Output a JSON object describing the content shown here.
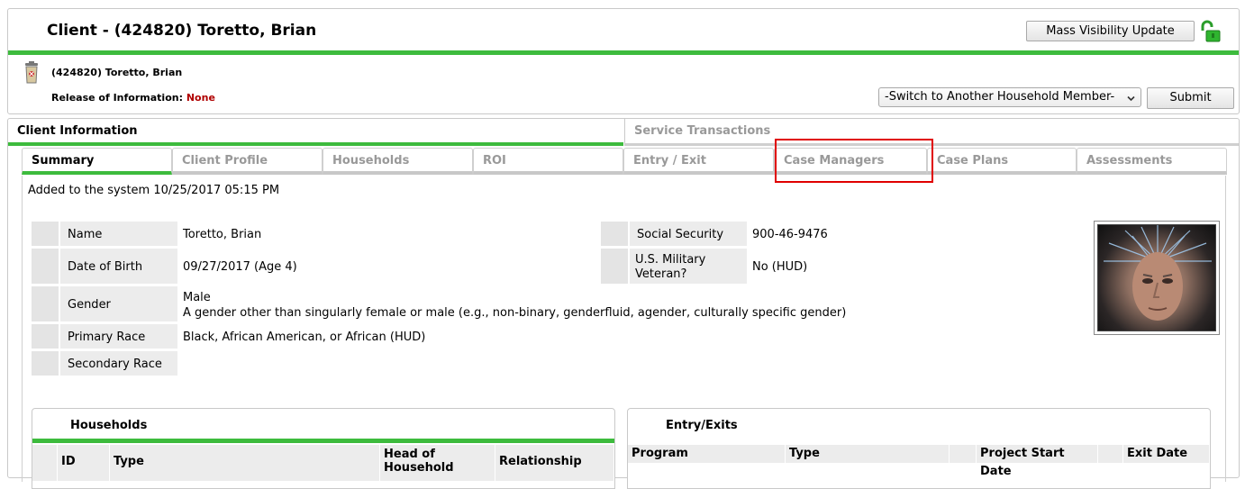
{
  "header": {
    "title": "Client - (424820) Toretto, Brian",
    "mass_visibility_label": "Mass Visibility Update",
    "client_line": "(424820) Toretto, Brian",
    "roi_label": "Release of Information:",
    "roi_value": "None",
    "switch_member_selected": "-Switch to Another Household Member-",
    "submit_label": "Submit",
    "lock_icon": "unlocked-padlock-icon",
    "trash_icon": "trash-can-icon",
    "accent_color": "#3dbb3d"
  },
  "main_tabs": [
    {
      "label": "Client Information",
      "active": true
    },
    {
      "label": "Service Transactions",
      "active": false
    }
  ],
  "sub_tabs": [
    {
      "label": "Summary",
      "active": true
    },
    {
      "label": "Client Profile",
      "active": false
    },
    {
      "label": "Households",
      "active": false
    },
    {
      "label": "ROI",
      "active": false
    },
    {
      "label": "Entry / Exit",
      "active": false
    },
    {
      "label": "Case Managers",
      "active": false,
      "highlighted": true
    },
    {
      "label": "Case Plans",
      "active": false
    },
    {
      "label": "Assessments",
      "active": false
    }
  ],
  "summary": {
    "added_line": "Added to the system 10/25/2017 05:15 PM",
    "fields_left": [
      {
        "label": "Name",
        "value": "Toretto, Brian"
      },
      {
        "label": "Date of Birth",
        "value": "09/27/2017 (Age 4)"
      },
      {
        "label": "Gender",
        "value_line1": "Male",
        "value_line2": "A gender other than singularly female or male (e.g., non-binary, genderfluid, agender, culturally specific gender)"
      },
      {
        "label": "Primary Race",
        "value": "Black, African American, or African (HUD)"
      },
      {
        "label": "Secondary Race",
        "value": ""
      }
    ],
    "fields_right": [
      {
        "label": "Social Security",
        "value": "900-46-9476"
      },
      {
        "label_line1": "U.S. Military",
        "label_line2": "Veteran?",
        "value": "No (HUD)"
      }
    ]
  },
  "households_panel": {
    "title": "Households",
    "columns": [
      "ID",
      "Type",
      "Head of Household",
      "Relationship"
    ],
    "column_head_line1": "Head of",
    "column_head_line2": "Household"
  },
  "entry_exits_panel": {
    "title": "Entry/Exits",
    "columns": [
      "Program",
      "Type",
      "",
      "Project Start Date",
      "",
      "Exit Date"
    ]
  }
}
